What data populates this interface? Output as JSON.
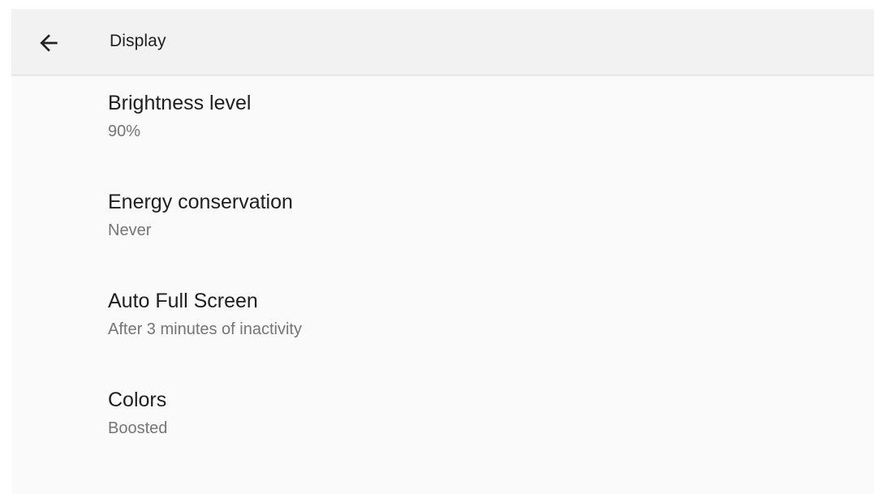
{
  "header": {
    "title": "Display",
    "back_icon": "arrow-back-icon"
  },
  "settings": [
    {
      "title": "Brightness level",
      "value": "90%"
    },
    {
      "title": "Energy conservation",
      "value": "Never"
    },
    {
      "title": "Auto Full Screen",
      "value": "After 3 minutes of inactivity"
    },
    {
      "title": "Colors",
      "value": "Boosted"
    }
  ],
  "colors": {
    "background": "#fafafa",
    "appbar": "#f2f2f2",
    "title_text": "#1f1f1f",
    "secondary_text": "#757575"
  }
}
